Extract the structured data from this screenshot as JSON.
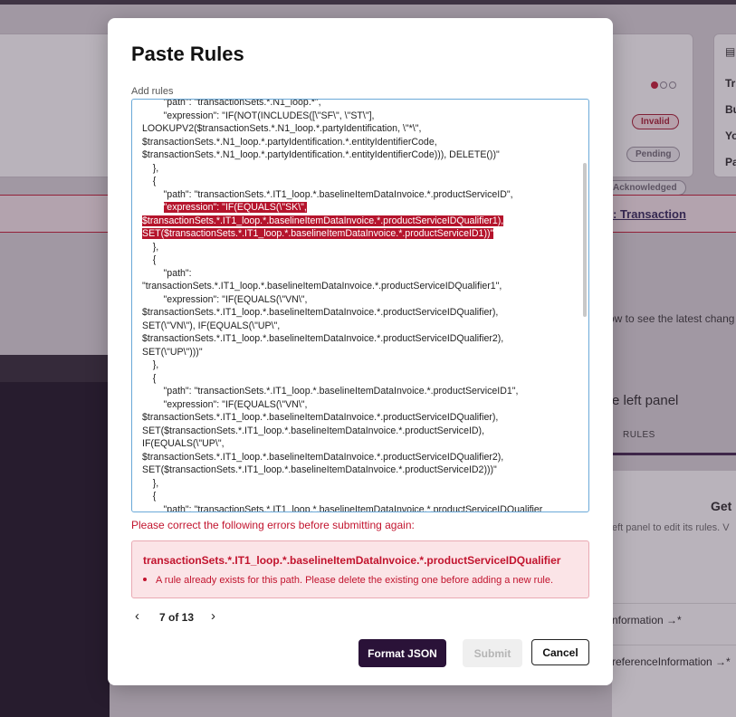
{
  "background": {
    "badges": [
      "Invalid",
      "Pending",
      "Acknowledged"
    ],
    "side_rows": [
      "Tr",
      "Bu",
      "Yo",
      "Pa"
    ],
    "banner_link": ": Transaction",
    "info_text": "ow to see the latest chang",
    "left_panel_text": "e left panel",
    "tab_rules": "RULES",
    "get_heading": "Get",
    "hint_text": "eft panel to edit its rules. V",
    "rows": [
      "nformation →*",
      "referenceInformation →*"
    ]
  },
  "modal": {
    "title": "Paste Rules",
    "field_label": "Add rules",
    "code_lines": [
      {
        "text": "        \"path\": \"transactionSets.*.N1_loop.*\",",
        "hl": false
      },
      {
        "text": "        \"expression\": \"IF(NOT(INCLUDES([\\\"SF\\\", \\\"ST\\\"],",
        "hl": false
      },
      {
        "text": "LOOKUPV2($transactionSets.*.N1_loop.*.partyIdentification, \\\"*\\\",",
        "hl": false
      },
      {
        "text": "$transactionSets.*.N1_loop.*.partyIdentification.*.entityIdentifierCode,",
        "hl": false
      },
      {
        "text": "$transactionSets.*.N1_loop.*.partyIdentification.*.entityIdentifierCode))), DELETE())\"",
        "hl": false
      },
      {
        "text": "    },",
        "hl": false
      },
      {
        "text": "    {",
        "hl": false
      },
      {
        "text": "        \"path\": \"transactionSets.*.IT1_loop.*.baselineItemDataInvoice.*.productServiceID\",",
        "hl": false
      },
      {
        "text": "        \"expression\": \"IF(EQUALS(\\\"SK\\\",",
        "hl": true
      },
      {
        "text": "$transactionSets.*.IT1_loop.*.baselineItemDataInvoice.*.productServiceIDQualifier1),",
        "hl": true
      },
      {
        "text": "SET($transactionSets.*.IT1_loop.*.baselineItemDataInvoice.*.productServiceID1))\"",
        "hl": true
      },
      {
        "text": "    },",
        "hl": false
      },
      {
        "text": "    {",
        "hl": false
      },
      {
        "text": "        \"path\":",
        "hl": false
      },
      {
        "text": "\"transactionSets.*.IT1_loop.*.baselineItemDataInvoice.*.productServiceIDQualifier1\",",
        "hl": false
      },
      {
        "text": "        \"expression\": \"IF(EQUALS(\\\"VN\\\",",
        "hl": false
      },
      {
        "text": "$transactionSets.*.IT1_loop.*.baselineItemDataInvoice.*.productServiceIDQualifier),",
        "hl": false
      },
      {
        "text": "SET(\\\"VN\\\"), IF(EQUALS(\\\"UP\\\",",
        "hl": false
      },
      {
        "text": "$transactionSets.*.IT1_loop.*.baselineItemDataInvoice.*.productServiceIDQualifier2),",
        "hl": false
      },
      {
        "text": "SET(\\\"UP\\\")))\"",
        "hl": false
      },
      {
        "text": "    },",
        "hl": false
      },
      {
        "text": "    {",
        "hl": false
      },
      {
        "text": "        \"path\": \"transactionSets.*.IT1_loop.*.baselineItemDataInvoice.*.productServiceID1\",",
        "hl": false
      },
      {
        "text": "        \"expression\": \"IF(EQUALS(\\\"VN\\\",",
        "hl": false
      },
      {
        "text": "$transactionSets.*.IT1_loop.*.baselineItemDataInvoice.*.productServiceIDQualifier),",
        "hl": false
      },
      {
        "text": "SET($transactionSets.*.IT1_loop.*.baselineItemDataInvoice.*.productServiceID),",
        "hl": false
      },
      {
        "text": "IF(EQUALS(\\\"UP\\\",",
        "hl": false
      },
      {
        "text": "$transactionSets.*.IT1_loop.*.baselineItemDataInvoice.*.productServiceIDQualifier2),",
        "hl": false
      },
      {
        "text": "SET($transactionSets.*.IT1_loop.*.baselineItemDataInvoice.*.productServiceID2)))\"",
        "hl": false
      },
      {
        "text": "    },",
        "hl": false
      },
      {
        "text": "    {",
        "hl": false
      },
      {
        "text": "        \"path\": \"transactionSets.*.IT1_loop.*.baselineItemDataInvoice.*.productServiceIDQualifier",
        "hl": false
      }
    ],
    "error_message": "Please correct the following errors before submitting again:",
    "error_path": "transactionSets.*.IT1_loop.*.baselineItemDataInvoice.*.productServiceIDQualifier",
    "error_item": "A rule already exists for this path. Please delete the existing one before adding a new rule.",
    "pager": {
      "prev_icon": "‹",
      "count": "7 of 13",
      "next_icon": "›"
    },
    "buttons": {
      "format": "Format JSON",
      "submit": "Submit",
      "cancel": "Cancel"
    }
  },
  "colors": {
    "accent": "#c2142e",
    "primary": "#2a1238"
  }
}
